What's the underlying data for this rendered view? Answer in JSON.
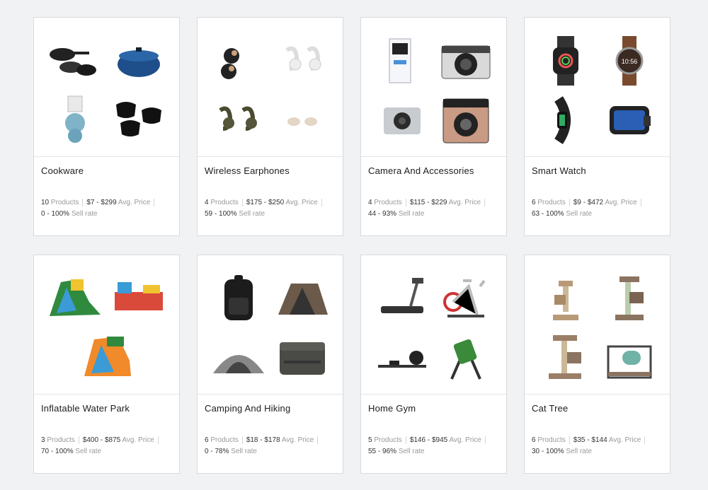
{
  "cards": [
    {
      "title": "Cookware",
      "products_count": "10",
      "products_label": "Products",
      "price_range": "$7 - $299",
      "price_label": "Avg. Price",
      "sell_rate": "0 - 100%",
      "sell_label": "Sell rate",
      "thumbs": [
        "pots-pans-icon",
        "dutch-oven-icon",
        "measuring-cups-icon",
        "face-masks-icon"
      ]
    },
    {
      "title": "Wireless Earphones",
      "products_count": "4",
      "products_label": "Products",
      "price_range": "$175 - $250",
      "price_label": "Avg. Price",
      "sell_rate": "59 - 100%",
      "sell_label": "Sell rate",
      "thumbs": [
        "black-earbuds-icon",
        "white-earbuds-icon",
        "olive-earbuds-icon",
        "beige-earbuds-icon"
      ]
    },
    {
      "title": "Camera And Accessories",
      "products_count": "4",
      "products_label": "Products",
      "price_range": "$115 - $229",
      "price_label": "Avg. Price",
      "sell_rate": "44 - 93%",
      "sell_label": "Sell rate",
      "thumbs": [
        "action-camera-box-icon",
        "instant-camera-icon",
        "action-camera-icon",
        "rose-instant-camera-icon"
      ]
    },
    {
      "title": "Smart Watch",
      "products_count": "6",
      "products_label": "Products",
      "price_range": "$9 - $472",
      "price_label": "Avg. Price",
      "sell_rate": "63 - 100%",
      "sell_label": "Sell rate",
      "thumbs": [
        "square-watch-icon",
        "round-watch-icon",
        "fitness-band-icon",
        "curved-watch-icon"
      ]
    },
    {
      "title": "Inflatable Water Park",
      "products_count": "3",
      "products_label": "Products",
      "price_range": "$400 - $875",
      "price_label": "Avg. Price",
      "sell_rate": "70 - 100%",
      "sell_label": "Sell rate",
      "thumbs": [
        "water-slide-icon",
        "bounce-park-icon",
        "water-slide-big-icon",
        ""
      ]
    },
    {
      "title": "Camping And Hiking",
      "products_count": "6",
      "products_label": "Products",
      "price_range": "$18 - $178",
      "price_label": "Avg. Price",
      "sell_rate": "0 - 78%",
      "sell_label": "Sell rate",
      "thumbs": [
        "backpack-icon",
        "tent-icon",
        "dome-tent-icon",
        "cooler-icon"
      ]
    },
    {
      "title": "Home Gym",
      "products_count": "5",
      "products_label": "Products",
      "price_range": "$146 - $945",
      "price_label": "Avg. Price",
      "sell_rate": "55 - 96%",
      "sell_label": "Sell rate",
      "thumbs": [
        "treadmill-icon",
        "exercise-bike-icon",
        "rowing-machine-icon",
        "inversion-table-icon"
      ]
    },
    {
      "title": "Cat Tree",
      "products_count": "6",
      "products_label": "Products",
      "price_range": "$35 - $144",
      "price_label": "Avg. Price",
      "sell_rate": "30 - 100%",
      "sell_label": "Sell rate",
      "thumbs": [
        "small-cat-tree-icon",
        "tall-cat-tree-icon",
        "cat-condo-icon",
        "cat-playhouse-icon"
      ]
    }
  ],
  "colors": {
    "page_bg": "#f1f2f4",
    "card_border": "#d9dadd",
    "muted_text": "#999999"
  }
}
